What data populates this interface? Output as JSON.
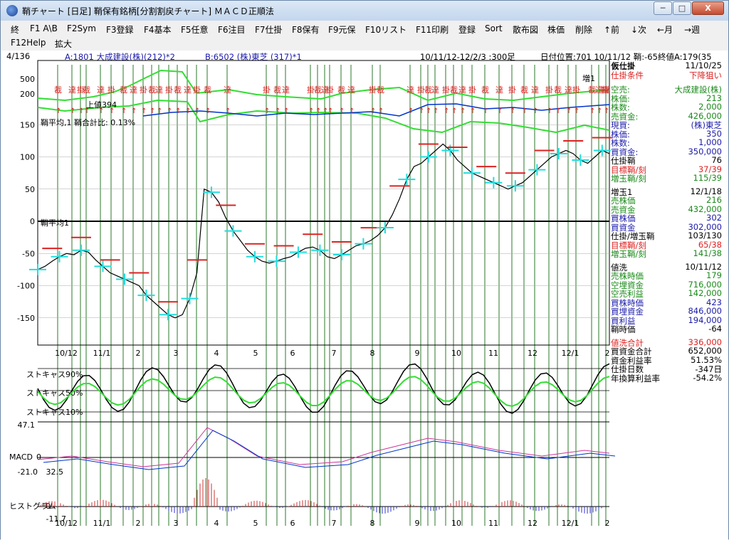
{
  "window": {
    "title": "鞘チャート  [日足]  鞘保有銘柄[分割割戻チャート] ＭＡＣＤ正順法",
    "min_label": "─",
    "max_label": "□",
    "close_label": "X"
  },
  "menu": {
    "row1": [
      "終",
      "F1 A\\B",
      "F2Sym",
      "F3登録",
      "F4基本",
      "F5任意",
      "F6注目",
      "F7仕掛",
      "F8保有",
      "F9元保",
      "F10リスト",
      "F11印刷",
      "登録",
      "Sort",
      "散布図",
      "株価",
      "削除",
      "↑前",
      "↓次",
      "←月",
      "→週"
    ],
    "row2": [
      "F12Help",
      "拡大"
    ]
  },
  "header": {
    "index": "4/136",
    "stock_a": "A:1801 大成建設(株)(212)*2",
    "stock_b": "B:6502 (株)東芝 (317)*1",
    "range": "10/11/12-12/2/3 :300足",
    "date_pos": "日付位置:701 10/11/12 鞘:-65終値A:179(35"
  },
  "colors": {
    "green_line": "#33dd33",
    "blue_line": "#0033cc",
    "red": "#dd2222",
    "cyan": "#22dddd",
    "vline": "#2a7a2a",
    "black": "#000000"
  },
  "chart_labels": {
    "kari_label": "仮仕掛",
    "shinsa_label": "鞘平均,1 鞘合計比: 0.13%",
    "heikin_label": "鞘平均1",
    "sidewise_label": "上値394",
    "stoch90": "ストキャス90%",
    "stoch50": "ストキャス50%",
    "stoch10": "ストキャス10%",
    "macd_label": "MACD",
    "hist_label": "ヒストグラム"
  },
  "chart_data": {
    "type": "line",
    "main_y_ticks": [
      "500",
      "200",
      "150",
      "100",
      "50",
      "0",
      "-50",
      "-100",
      "-150"
    ],
    "stoch_top_tick": "47.1",
    "macd_ticks": [
      "0",
      "-21.0"
    ],
    "hist_ticks": [
      "32.5",
      "0",
      "-11.7"
    ],
    "x_tick_labels": [
      "10/12",
      "11/1",
      "2",
      "3",
      "4",
      "5",
      "6",
      "7",
      "8",
      "9",
      "10",
      "11",
      "12",
      "12/1",
      "2"
    ],
    "spread_series": [
      -75,
      -70,
      -62,
      -55,
      -50,
      -52,
      -45,
      -48,
      -60,
      -70,
      -80,
      -85,
      -90,
      -95,
      -100,
      -115,
      -125,
      -135,
      -145,
      -150,
      -145,
      -120,
      -80,
      50,
      45,
      30,
      5,
      -15,
      -30,
      -45,
      -55,
      -62,
      -65,
      -62,
      -58,
      -55,
      -48,
      -42,
      -40,
      -45,
      -55,
      -58,
      -52,
      -45,
      -38,
      -35,
      -30,
      -22,
      -10,
      10,
      35,
      65,
      85,
      90,
      100,
      110,
      120,
      110,
      95,
      85,
      75,
      70,
      65,
      60,
      55,
      50,
      55,
      60,
      70,
      80,
      90,
      100,
      105,
      110,
      105,
      95,
      90,
      100,
      110,
      105
    ],
    "annotation_words": [
      "裁",
      "達",
      "掛",
      "増1",
      "鞘"
    ]
  },
  "side_panel": {
    "title": "仮仕掛",
    "title_date": "11/10/25",
    "cond_label": "仕掛条件",
    "cond_value": "下降狙い",
    "short_label": "空売:",
    "short_name": "大成建設(株)",
    "rows_a": [
      {
        "label": "株価:",
        "value": "213",
        "color": "#1a8a1a"
      },
      {
        "label": "株数:",
        "value": "2,000",
        "color": "#1a8a1a"
      },
      {
        "label": "売資金:",
        "value": "426,000",
        "color": "#1a8a1a"
      }
    ],
    "long_label": "現買:",
    "long_name": "(株)東芝",
    "rows_b": [
      {
        "label": "株価:",
        "value": "350",
        "color": "#1a1aaa"
      },
      {
        "label": "株数:",
        "value": "1,000",
        "color": "#1a1aaa"
      },
      {
        "label": "買資金:",
        "value": "350,000",
        "color": "#1a1aaa"
      }
    ],
    "rows_c": [
      {
        "label": "仕掛鞘",
        "value": "76",
        "color": "#000"
      },
      {
        "label": "目標鞘/刻",
        "value": "37/39",
        "color": "#dd2222"
      },
      {
        "label": "増玉鞘/刻",
        "value": "115/39",
        "color": "#1a8a1a"
      }
    ],
    "add_title": "増玉1",
    "add_date": "12/1/18",
    "rows_d": [
      {
        "label": "売株価",
        "value": "216",
        "color": "#1a8a1a"
      },
      {
        "label": "売資金",
        "value": "432,000",
        "color": "#1a8a1a"
      },
      {
        "label": "買株価",
        "value": "302",
        "color": "#1a1aaa"
      },
      {
        "label": "買資金",
        "value": "302,000",
        "color": "#1a1aaa"
      },
      {
        "label": "仕掛/増玉鞘",
        "value": "103/130",
        "color": "#000"
      },
      {
        "label": "目標鞘/刻",
        "value": "65/38",
        "color": "#dd2222"
      },
      {
        "label": "増玉鞘/刻",
        "value": "141/38",
        "color": "#1a8a1a"
      }
    ],
    "wash_title": "値洗",
    "wash_date": "10/11/12",
    "rows_e": [
      {
        "label": "売株時価",
        "value": "179",
        "color": "#1a8a1a"
      },
      {
        "label": "空埋資金",
        "value": "716,000",
        "color": "#1a8a1a"
      },
      {
        "label": "空売利益",
        "value": "142,000",
        "color": "#1a8a1a"
      },
      {
        "label": "買株時価",
        "value": "423",
        "color": "#1a1aaa"
      },
      {
        "label": "買埋資金",
        "value": "846,000",
        "color": "#1a1aaa"
      },
      {
        "label": "買利益",
        "value": "194,000",
        "color": "#1a1aaa"
      },
      {
        "label": "鞘時価",
        "value": "-64",
        "color": "#000"
      }
    ],
    "total_label": "値洗合計",
    "total_value": "336,000",
    "rows_f": [
      {
        "label": "買資金合計",
        "value": "652,000",
        "color": "#000"
      },
      {
        "label": "資金利益率",
        "value": "51.53%",
        "color": "#000"
      },
      {
        "label": "仕掛日数",
        "value": "-347日",
        "color": "#000"
      },
      {
        "label": "年換算利益率",
        "value": "-54.2%",
        "color": "#000"
      }
    ]
  }
}
